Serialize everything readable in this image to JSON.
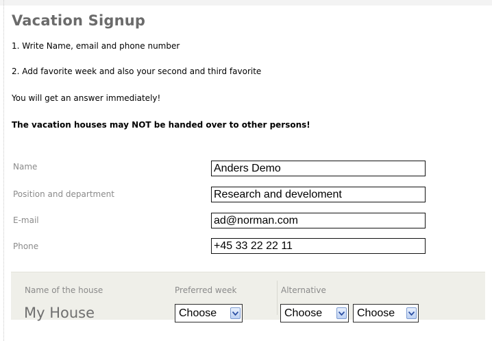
{
  "page": {
    "title": "Vacation Signup",
    "instructions": [
      "1. Write Name, email and phone number",
      "2. Add favorite week and also your second and third favorite",
      "You will get an answer immediately!"
    ],
    "warning": "The vacation houses may NOT be handed over to other persons!"
  },
  "form": {
    "name_label": "Name",
    "name_value": "Anders Demo",
    "position_label": "Position and department",
    "position_value": "Research and develoment",
    "email_label": "E-mail",
    "email_value": "ad@norman.com",
    "phone_label": "Phone",
    "phone_value": "+45 33 22 22 11"
  },
  "house": {
    "name_label": "Name of the house",
    "name": "My House",
    "preferred_label": "Preferred week",
    "preferred_value": "Choose",
    "alternative_label": "Alternative",
    "alternative_values": [
      "Choose",
      "Choose"
    ]
  },
  "colors": {
    "title": "#6b6b6b",
    "label": "#8a8a8a",
    "panel": "#efefe9",
    "dropdown_arrow": "#2b4fa3"
  }
}
